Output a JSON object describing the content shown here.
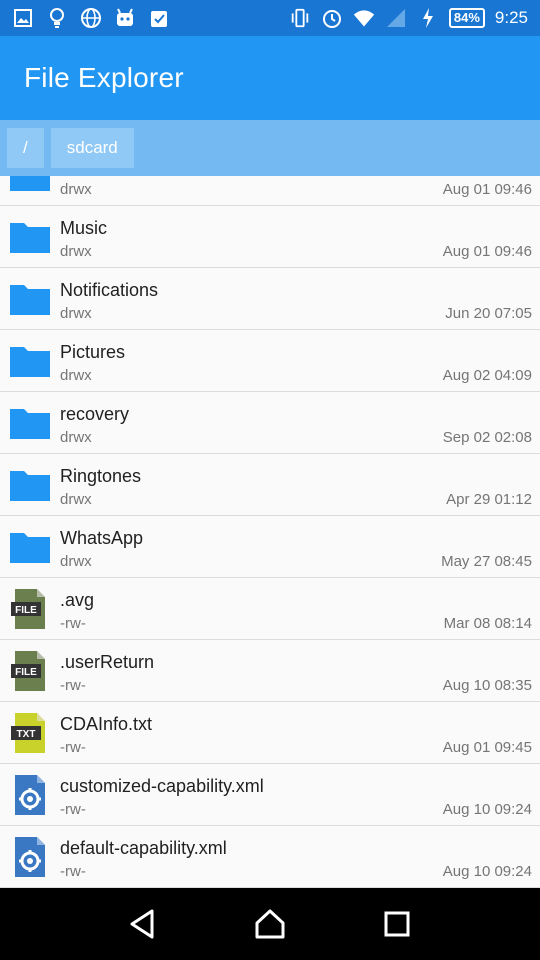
{
  "status_bar": {
    "battery": "84%",
    "time": "9:25",
    "left_icons": [
      "image-icon",
      "lightbulb-icon",
      "globe-icon",
      "android-icon",
      "clipboard-check-icon"
    ],
    "right_icons": [
      "vibrate-icon",
      "alarm-icon",
      "wifi-icon",
      "signal-icon",
      "charging-icon"
    ]
  },
  "app_bar": {
    "title": "File Explorer"
  },
  "breadcrumb": [
    {
      "label": "/"
    },
    {
      "label": "sdcard"
    }
  ],
  "files": [
    {
      "name": "",
      "perm": "drwx",
      "date": "Aug 01 09:46",
      "type": "folder"
    },
    {
      "name": "Music",
      "perm": "drwx",
      "date": "Aug 01 09:46",
      "type": "folder"
    },
    {
      "name": "Notifications",
      "perm": "drwx",
      "date": "Jun 20 07:05",
      "type": "folder"
    },
    {
      "name": "Pictures",
      "perm": "drwx",
      "date": "Aug 02 04:09",
      "type": "folder"
    },
    {
      "name": "recovery",
      "perm": "drwx",
      "date": "Sep 02 02:08",
      "type": "folder"
    },
    {
      "name": "Ringtones",
      "perm": "drwx",
      "date": "Apr 29 01:12",
      "type": "folder"
    },
    {
      "name": "WhatsApp",
      "perm": "drwx",
      "date": "May 27 08:45",
      "type": "folder"
    },
    {
      "name": ".avg",
      "perm": "-rw-",
      "date": "Mar 08 08:14",
      "type": "file",
      "badge": "FILE"
    },
    {
      "name": ".userReturn",
      "perm": "-rw-",
      "date": "Aug 10 08:35",
      "type": "file",
      "badge": "FILE"
    },
    {
      "name": "CDAInfo.txt",
      "perm": "-rw-",
      "date": "Aug 01 09:45",
      "type": "txt",
      "badge": "TXT"
    },
    {
      "name": "customized-capability.xml",
      "perm": "-rw-",
      "date": "Aug 10 09:24",
      "type": "xml"
    },
    {
      "name": "default-capability.xml",
      "perm": "-rw-",
      "date": "Aug 10 09:24",
      "type": "xml"
    }
  ],
  "colors": {
    "status_bar": "#1976d2",
    "app_bar": "#2196f3",
    "breadcrumb_bg": "#74b9f2",
    "crumb_bg": "#90c8f6",
    "folder": "#2196f3",
    "file_icon": "#6b7f4e",
    "txt_icon": "#c8d22a",
    "xml_icon": "#3a78c3"
  },
  "nav_bar": {
    "buttons": [
      {
        "name": "back-button",
        "icon": "back-triangle-icon"
      },
      {
        "name": "home-button",
        "icon": "home-icon"
      },
      {
        "name": "recents-button",
        "icon": "recents-square-icon"
      }
    ]
  }
}
